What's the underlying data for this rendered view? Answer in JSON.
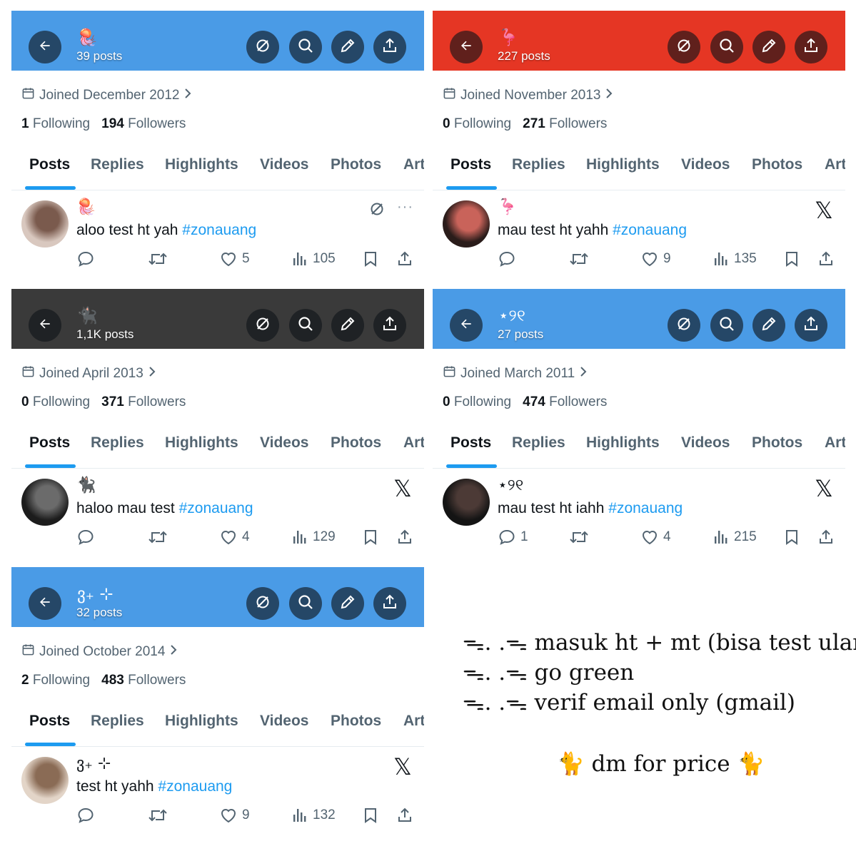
{
  "cards": [
    {
      "header_color": "#4a9be6",
      "emoji": "🪼",
      "posts_count": "39 posts",
      "joined": "Joined December 2012",
      "following": "1",
      "following_label": "Following",
      "followers": "194",
      "followers_label": "Followers",
      "post_emoji": "🪼",
      "post_text": "aloo test ht yah",
      "hashtag": "#zonauang",
      "replies": "",
      "likes": "5",
      "views": "105",
      "badge": "grok"
    },
    {
      "header_color": "#e53624",
      "emoji": "🦩",
      "posts_count": "227 posts",
      "joined": "Joined November 2013",
      "following": "0",
      "following_label": "Following",
      "followers": "271",
      "followers_label": "Followers",
      "post_emoji": "🦩",
      "post_text": "mau test ht yahh",
      "hashtag": "#zonauang",
      "replies": "",
      "likes": "9",
      "views": "135",
      "badge": "x"
    },
    {
      "header_color": "#3a3a3a",
      "emoji": "🐈‍⬛",
      "posts_count": "1,1K posts",
      "joined": "Joined April 2013",
      "following": "0",
      "following_label": "Following",
      "followers": "371",
      "followers_label": "Followers",
      "post_emoji": "🐈‍⬛",
      "post_text": "haloo mau test",
      "hashtag": "#zonauang",
      "replies": "",
      "likes": "4",
      "views": "129",
      "badge": "x"
    },
    {
      "header_color": "#4a9be6",
      "emoji": "⋆୨୧",
      "posts_count": "27 posts",
      "joined": "Joined March 2011",
      "following": "0",
      "following_label": "Following",
      "followers": "474",
      "followers_label": "Followers",
      "post_emoji": "⋆୨୧",
      "post_text": "mau test ht iahh",
      "hashtag": "#zonauang",
      "replies": "1",
      "likes": "4",
      "views": "215",
      "badge": "x"
    },
    {
      "header_color": "#4a9be6",
      "emoji": "ვ₊ ⊹",
      "posts_count": "32 posts",
      "joined": "Joined October 2014",
      "following": "2",
      "following_label": "Following",
      "followers": "483",
      "followers_label": "Followers",
      "post_emoji": "ვ₊ ⊹",
      "post_text": "test ht yahh",
      "hashtag": "#zonauang",
      "replies": "",
      "likes": "9",
      "views": "132",
      "badge": "x"
    }
  ],
  "tabs": [
    "Posts",
    "Replies",
    "Highlights",
    "Videos",
    "Photos",
    "Art"
  ],
  "footer": {
    "lines": [
      "ᯓ. .ᯓ masuk ht + mt (bisa test ulang)",
      "ᯓ. .ᯓ go green",
      "ᯓ. .ᯓ verif email only (gmail)"
    ],
    "dm": "🐈 dm for price 🐈"
  }
}
